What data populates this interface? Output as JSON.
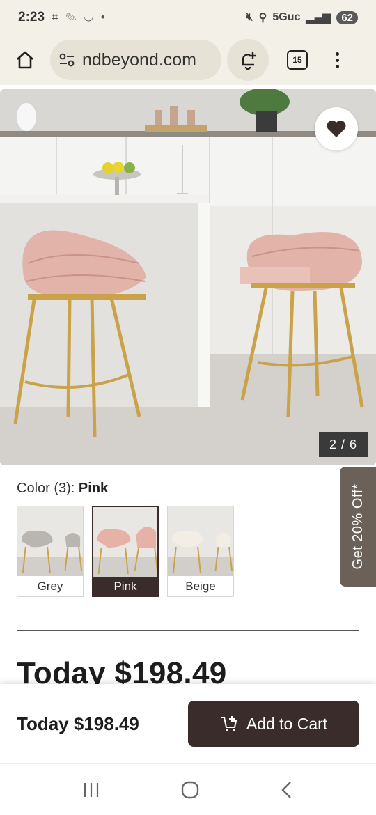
{
  "status_bar": {
    "time": "2:23",
    "network": "5Guc",
    "battery": "62"
  },
  "browser": {
    "url": "ndbeyond.com",
    "tab_count": "15"
  },
  "gallery": {
    "counter": "2 / 6"
  },
  "promo": {
    "label": "Get 20% Off*"
  },
  "color": {
    "label": "Color (3):",
    "selected": "Pink",
    "options": [
      {
        "name": "Grey",
        "tone": "#b9b6b1"
      },
      {
        "name": "Pink",
        "tone": "#e6b1a6"
      },
      {
        "name": "Beige",
        "tone": "#ede6d8"
      }
    ]
  },
  "price": {
    "headline": "Today $198.49",
    "sticky": "Today $198.49"
  },
  "cart": {
    "button_label": "Add to Cart"
  },
  "colors": {
    "accent": "#3a2c2a",
    "chrome": "#f3f1e7",
    "promo": "#6b6159"
  }
}
